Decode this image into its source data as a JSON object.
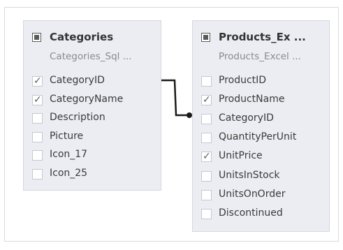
{
  "left_table": {
    "title": "Categories",
    "subtitle": "Categories_Sql ...",
    "fields": [
      {
        "label": "CategoryID",
        "checked": true
      },
      {
        "label": "CategoryName",
        "checked": true
      },
      {
        "label": "Description",
        "checked": false
      },
      {
        "label": "Picture",
        "checked": false
      },
      {
        "label": "Icon_17",
        "checked": false
      },
      {
        "label": "Icon_25",
        "checked": false
      }
    ]
  },
  "right_table": {
    "title": "Products_Ex ...",
    "subtitle": "Products_Excel ...",
    "fields": [
      {
        "label": "ProductID",
        "checked": false
      },
      {
        "label": "ProductName",
        "checked": true
      },
      {
        "label": "CategoryID",
        "checked": false
      },
      {
        "label": "QuantityPerUnit",
        "checked": false
      },
      {
        "label": "UnitPrice",
        "checked": true
      },
      {
        "label": "UnitsInStock",
        "checked": false
      },
      {
        "label": "UnitsOnOrder",
        "checked": false
      },
      {
        "label": "Discontinued",
        "checked": false
      }
    ]
  },
  "colors": {
    "table_bg": "#ecedf3",
    "relation_line": "#1a1a1a"
  },
  "icons": {
    "table_icon": "table-icon",
    "check_icon": "check-icon"
  }
}
